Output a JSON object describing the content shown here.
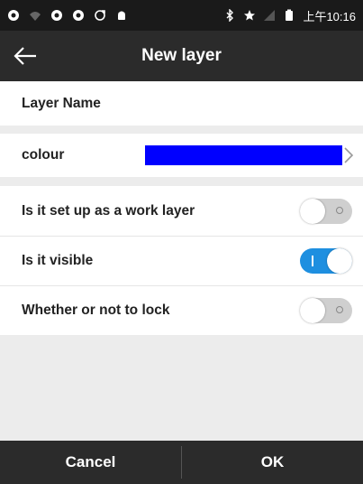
{
  "status_bar": {
    "time": "上午10:16",
    "left_icons": [
      "app-icon-1",
      "wifi-icon",
      "app-icon-2",
      "app-icon-3",
      "sync-icon",
      "android-icon"
    ],
    "right_icons": [
      "bluetooth-icon",
      "star-icon",
      "signal-icon",
      "battery-icon"
    ]
  },
  "app_bar": {
    "title": "New layer",
    "back_icon": "arrow-left-icon"
  },
  "form": {
    "layer_name_label": "Layer Name",
    "colour_label": "colour",
    "colour_value": "#0000ff",
    "work_layer_label": "Is it set up as a work layer",
    "work_layer_on": false,
    "visible_label": "Is it visible",
    "visible_on": true,
    "lock_label": "Whether or not to lock",
    "lock_on": false
  },
  "footer": {
    "cancel_label": "Cancel",
    "ok_label": "OK"
  },
  "colors": {
    "appbar_bg": "#2b2b2b",
    "toggle_on": "#1e8fe0",
    "toggle_off": "#cfcfcf"
  }
}
